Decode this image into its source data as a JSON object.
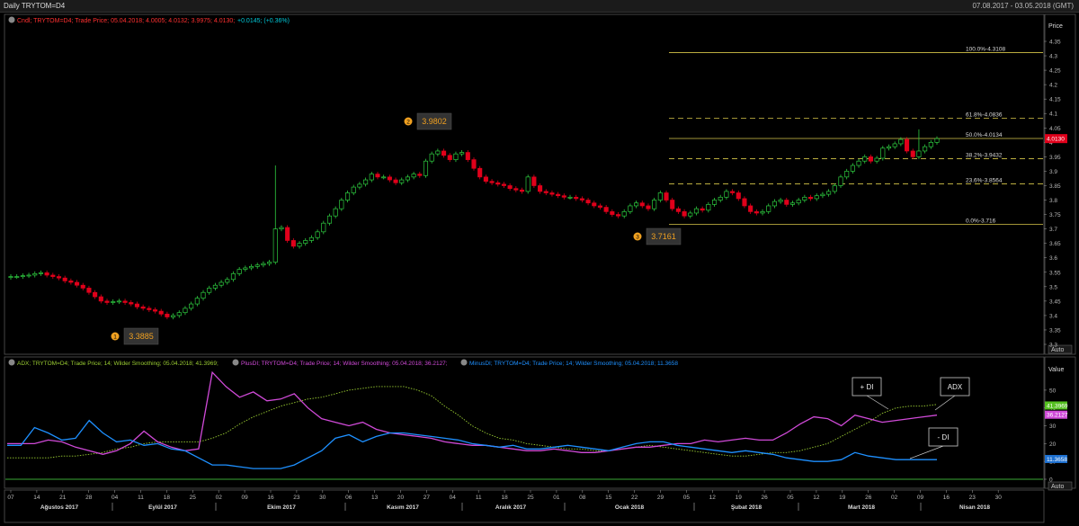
{
  "window": {
    "title": "Daily TRYTOM=D4",
    "date_range": "07.08.2017 - 03.05.2018 (GMT)"
  },
  "price_panel": {
    "legend_main": "Cndl; TRYTOM=D4; Trade Price; 05.04.2018; 4.0005; 4.0132; 3.9975; 4.0130;",
    "legend_change": "+0.0145; (+0.36%)",
    "axis_title": "Price",
    "last_price": "4.0130",
    "auto_label": "Auto",
    "yticks": [
      "4.35",
      "4.3",
      "4.25",
      "4.2",
      "4.15",
      "4.1",
      "4.05",
      "4",
      "3.95",
      "3.9",
      "3.85",
      "3.8",
      "3.75",
      "3.7",
      "3.65",
      "3.6",
      "3.55",
      "3.5",
      "3.45",
      "3.4",
      "3.35",
      "3.3"
    ]
  },
  "fibonacci": [
    {
      "label": "100.0%-4.3108",
      "value": 4.3108,
      "style": "solid"
    },
    {
      "label": "61.8%-4.0836",
      "value": 4.0836,
      "style": "dashed"
    },
    {
      "label": "50.0%-4.0134",
      "value": 4.0134,
      "style": "solid"
    },
    {
      "label": "38.2%-3.9432",
      "value": 3.9432,
      "style": "dashed"
    },
    {
      "label": "23.6%-3.8564",
      "value": 3.8564,
      "style": "dashed"
    },
    {
      "label": "0.0%-3.716",
      "value": 3.716,
      "style": "solid"
    }
  ],
  "pivots": [
    {
      "num": "1",
      "value": "3.3885"
    },
    {
      "num": "2",
      "value": "3.9802"
    },
    {
      "num": "3",
      "value": "3.7161"
    }
  ],
  "indicator_panel": {
    "legend_adx": "ADX; TRYTOM=D4; Trade Price; 14; Wilder Smoothing; 05.04.2018; 41.3969;",
    "legend_plus": "PlusDI; TRYTOM=D4; Trade Price; 14; Wilder Smoothing; 05.04.2018; 36.2127;",
    "legend_minus": "MinusDI; TRYTOM=D4; Trade Price; 14; Wilder Smoothing; 05.04.2018; 11.3658",
    "axis_title": "Value",
    "yticks": [
      "50",
      "40",
      "30",
      "20",
      "10",
      "0"
    ],
    "adx_value": "41.3969",
    "plus_value": "36.2127",
    "minus_value": "11.3658",
    "callout_plus": "+ DI",
    "callout_adx": "ADX",
    "callout_minus": "- DI",
    "auto_label": "Auto"
  },
  "x_axis": {
    "days": [
      "07",
      "14",
      "21",
      "28",
      "04",
      "11",
      "18",
      "25",
      "02",
      "09",
      "16",
      "23",
      "30",
      "06",
      "13",
      "20",
      "27",
      "04",
      "11",
      "18",
      "25",
      "01",
      "08",
      "15",
      "22",
      "29",
      "05",
      "12",
      "19",
      "26",
      "05",
      "12",
      "19",
      "26",
      "02",
      "09",
      "16",
      "23",
      "30"
    ],
    "months": [
      "Ağustos 2017",
      "Eylül 2017",
      "Ekim 2017",
      "Kasım 2017",
      "Aralık 2017",
      "Ocak 2018",
      "Şubat 2018",
      "Mart 2018",
      "Nisan 2018"
    ]
  },
  "colors": {
    "up": "#2ecc40",
    "down": "#e0001b",
    "fib": "#d7c64a",
    "adx": "#9acd32",
    "plus_di": "#d04ad8",
    "minus_di": "#1e90ff",
    "baseline": "#3aa836"
  },
  "chart_data": [
    {
      "type": "candlestick",
      "title": "Daily TRYTOM=D4",
      "ylabel": "Price",
      "ylim": [
        3.28,
        4.38
      ],
      "grid": false,
      "close": [
        3.535,
        3.535,
        3.538,
        3.54,
        3.545,
        3.548,
        3.54,
        3.535,
        3.53,
        3.52,
        3.515,
        3.505,
        3.495,
        3.48,
        3.465,
        3.45,
        3.445,
        3.448,
        3.45,
        3.445,
        3.44,
        3.43,
        3.425,
        3.42,
        3.415,
        3.405,
        3.395,
        3.4,
        3.41,
        3.425,
        3.44,
        3.46,
        3.48,
        3.495,
        3.505,
        3.515,
        3.525,
        3.545,
        3.56,
        3.565,
        3.57,
        3.575,
        3.58,
        3.585,
        3.7,
        3.705,
        3.66,
        3.64,
        3.65,
        3.66,
        3.67,
        3.69,
        3.72,
        3.745,
        3.77,
        3.8,
        3.825,
        3.845,
        3.855,
        3.87,
        3.89,
        3.88,
        3.88,
        3.87,
        3.86,
        3.87,
        3.88,
        3.89,
        3.885,
        3.935,
        3.96,
        3.97,
        3.955,
        3.94,
        3.96,
        3.965,
        3.94,
        3.91,
        3.88,
        3.865,
        3.86,
        3.855,
        3.85,
        3.84,
        3.835,
        3.83,
        3.88,
        3.85,
        3.83,
        3.825,
        3.82,
        3.815,
        3.81,
        3.81,
        3.805,
        3.8,
        3.79,
        3.78,
        3.775,
        3.76,
        3.75,
        3.745,
        3.76,
        3.78,
        3.79,
        3.78,
        3.77,
        3.8,
        3.825,
        3.8,
        3.77,
        3.76,
        3.745,
        3.755,
        3.77,
        3.765,
        3.785,
        3.8,
        3.81,
        3.83,
        3.825,
        3.805,
        3.78,
        3.76,
        3.755,
        3.76,
        3.78,
        3.795,
        3.8,
        3.785,
        3.79,
        3.8,
        3.81,
        3.805,
        3.815,
        3.82,
        3.83,
        3.85,
        3.88,
        3.9,
        3.92,
        3.935,
        3.95,
        3.935,
        3.945,
        3.98,
        3.985,
        3.995,
        4.01,
        3.97,
        3.95,
        3.97,
        3.985,
        4.0,
        4.013
      ]
    },
    {
      "type": "line",
      "ylabel": "Value",
      "ylim": [
        0,
        60
      ],
      "series": [
        {
          "name": "ADX",
          "values": [
            12,
            12,
            12,
            12,
            13,
            13,
            14,
            15,
            17,
            18,
            20,
            21,
            21,
            21,
            21,
            23,
            26,
            31,
            35,
            38,
            41,
            43,
            45,
            46,
            48,
            50,
            51,
            52,
            52,
            52,
            50,
            47,
            41,
            36,
            30,
            26,
            23,
            22,
            20,
            19,
            18,
            17,
            17,
            16,
            16,
            17,
            18,
            19,
            18,
            17,
            16,
            15,
            14,
            13,
            13,
            14,
            15,
            15,
            16,
            18,
            20,
            24,
            28,
            32,
            37,
            40,
            41,
            41,
            42
          ]
        },
        {
          "name": "PlusDI",
          "values": [
            20,
            20,
            20,
            22,
            21,
            18,
            16,
            14,
            16,
            20,
            27,
            21,
            18,
            16,
            17,
            60,
            52,
            46,
            49,
            44,
            45,
            48,
            40,
            34,
            32,
            30,
            32,
            28,
            26,
            25,
            24,
            23,
            21,
            20,
            19,
            19,
            18,
            17,
            16,
            16,
            17,
            16,
            15,
            15,
            16,
            17,
            18,
            18,
            19,
            20,
            20,
            22,
            21,
            22,
            23,
            22,
            22,
            26,
            31,
            35,
            34,
            30,
            36,
            34,
            32,
            33,
            34,
            35,
            36
          ]
        },
        {
          "name": "MinusDI",
          "values": [
            19,
            19,
            29,
            26,
            22,
            23,
            33,
            26,
            21,
            22,
            19,
            20,
            17,
            16,
            12,
            8,
            8,
            7,
            6,
            6,
            6,
            8,
            12,
            16,
            23,
            25,
            21,
            24,
            26,
            26,
            25,
            24,
            23,
            22,
            20,
            19,
            18,
            19,
            17,
            17,
            18,
            19,
            18,
            17,
            16,
            18,
            20,
            21,
            21,
            19,
            18,
            17,
            16,
            15,
            16,
            15,
            14,
            12,
            11,
            10,
            10,
            11,
            15,
            13,
            12,
            11,
            11,
            11,
            11
          ]
        }
      ]
    }
  ]
}
